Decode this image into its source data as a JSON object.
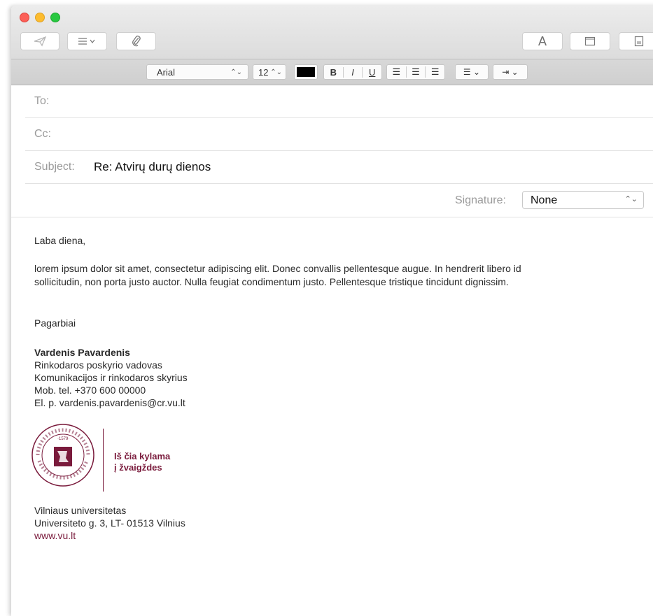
{
  "toolbar": {
    "send_icon": "send-icon",
    "header_fields_icon": "list-icon",
    "attach_icon": "paperclip-icon",
    "fonts_label": "A",
    "browser_icon": "photo-browser-icon",
    "stationery_icon": "stationery-icon"
  },
  "format": {
    "font_name": "Arial",
    "font_size": "12",
    "color": "#000000",
    "bold": "B",
    "italic": "I",
    "underline": "U"
  },
  "headers": {
    "to_label": "To:",
    "cc_label": "Cc:",
    "subject_label": "Subject:",
    "subject_value": "Re: Atvirų durų dienos",
    "signature_label": "Signature:",
    "signature_value": "None"
  },
  "message": {
    "greeting": "Laba diena,",
    "paragraph_line1": "lorem ipsum dolor sit amet, consectetur adipiscing elit. Donec convallis pellentesque augue. In hendrerit libero id",
    "paragraph_line2": "sollicitudin, non porta justo auctor. Nulla feugiat condimentum justo. Pellentesque tristique tincidunt dignissim.",
    "closing": "Pagarbiai"
  },
  "signature": {
    "name": "Vardenis Pavardenis",
    "position": "Rinkodaros poskyrio vadovas",
    "department": "Komunikacijos ir rinkodaros skyrius",
    "phone": "Mob. tel. +370 600 00000",
    "email": "El. p. vardenis.pavardenis@cr.vu.lt",
    "logo_text_top": "UNIVERSITAS · VILNIUS",
    "logo_year": "·1579·",
    "slogan_line1": "Iš čia kylama",
    "slogan_line2": "į žvaigždes",
    "org": "Vilniaus universitetas",
    "address": "Universiteto g. 3, LT- 01513 Vilnius",
    "website": "www.vu.lt",
    "brand_color": "#7a1b3c"
  }
}
